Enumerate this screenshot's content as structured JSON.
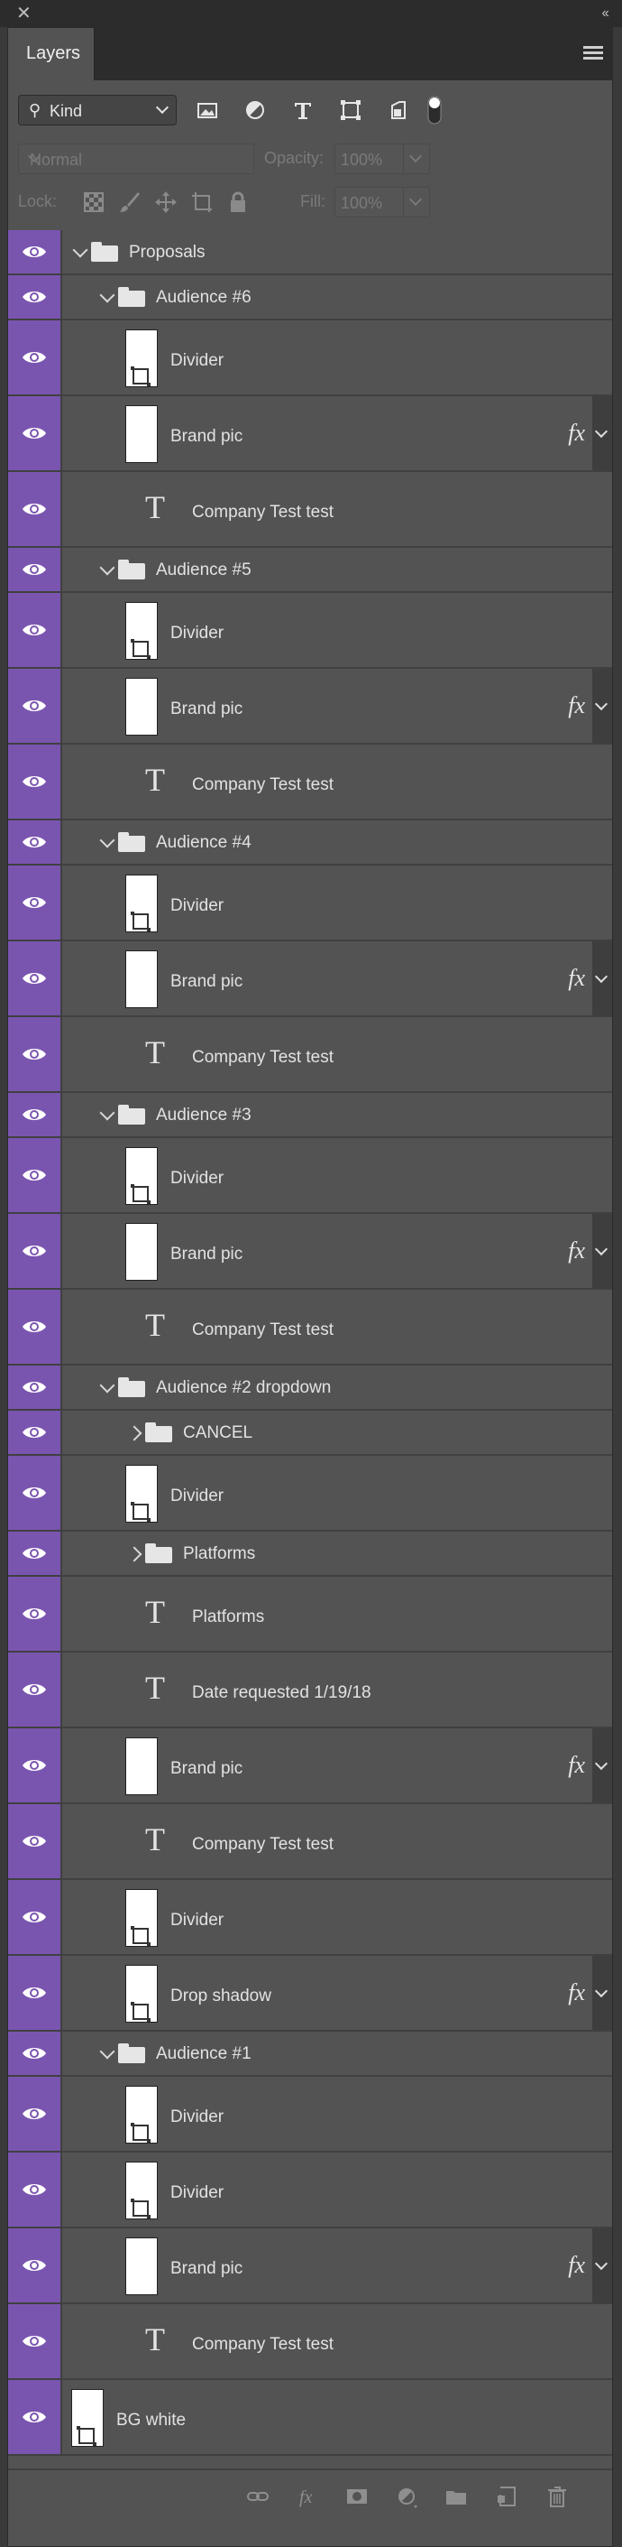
{
  "panel": {
    "tab_label": "Layers",
    "close_glyph": "✕",
    "collapse_glyph": "‹‹"
  },
  "filter": {
    "kind_label": "Kind",
    "icons": [
      "image-filter-icon",
      "adjustment-filter-icon",
      "type-filter-icon",
      "shape-filter-icon",
      "smart-object-filter-icon",
      "filter-toggle-icon"
    ]
  },
  "blend": {
    "mode": "Normal",
    "opacity_label": "Opacity:",
    "opacity_value": "100%",
    "lock_label": "Lock:",
    "fill_label": "Fill:",
    "fill_value": "100%"
  },
  "colors": {
    "visibility_column": "#7a55b0",
    "panel_bg": "#535353"
  },
  "layers": [
    {
      "name": "Proposals",
      "kind": "group",
      "depth": 0,
      "expanded": true
    },
    {
      "name": "Audience #6",
      "kind": "group",
      "depth": 1,
      "expanded": true
    },
    {
      "name": "Divider",
      "kind": "shape",
      "depth": 2
    },
    {
      "name": "Brand pic",
      "kind": "image",
      "depth": 2,
      "fx": true
    },
    {
      "name": "Company Test test",
      "kind": "text",
      "depth": 2
    },
    {
      "name": "Audience #5",
      "kind": "group",
      "depth": 1,
      "expanded": true
    },
    {
      "name": "Divider",
      "kind": "shape",
      "depth": 2
    },
    {
      "name": "Brand pic",
      "kind": "image",
      "depth": 2,
      "fx": true
    },
    {
      "name": "Company Test test",
      "kind": "text",
      "depth": 2
    },
    {
      "name": "Audience #4",
      "kind": "group",
      "depth": 1,
      "expanded": true
    },
    {
      "name": "Divider",
      "kind": "shape",
      "depth": 2
    },
    {
      "name": "Brand pic",
      "kind": "image",
      "depth": 2,
      "fx": true
    },
    {
      "name": "Company Test test",
      "kind": "text",
      "depth": 2
    },
    {
      "name": "Audience #3",
      "kind": "group",
      "depth": 1,
      "expanded": true
    },
    {
      "name": "Divider",
      "kind": "shape",
      "depth": 2
    },
    {
      "name": "Brand pic",
      "kind": "image",
      "depth": 2,
      "fx": true
    },
    {
      "name": "Company Test test",
      "kind": "text",
      "depth": 2
    },
    {
      "name": "Audience #2 dropdown",
      "kind": "group",
      "depth": 1,
      "expanded": true
    },
    {
      "name": "CANCEL",
      "kind": "group",
      "depth": 2,
      "expanded": false
    },
    {
      "name": "Divider",
      "kind": "shape",
      "depth": 2
    },
    {
      "name": "Platforms",
      "kind": "group",
      "depth": 2,
      "expanded": false
    },
    {
      "name": "Platforms",
      "kind": "text",
      "depth": 2
    },
    {
      "name": "Date requested 1/19/18",
      "kind": "text",
      "depth": 2
    },
    {
      "name": "Brand pic",
      "kind": "image",
      "depth": 2,
      "fx": true
    },
    {
      "name": "Company Test test",
      "kind": "text",
      "depth": 2
    },
    {
      "name": "Divider",
      "kind": "shape",
      "depth": 2
    },
    {
      "name": "Drop shadow",
      "kind": "shape",
      "depth": 2,
      "fx": true
    },
    {
      "name": "Audience #1",
      "kind": "group",
      "depth": 1,
      "expanded": true
    },
    {
      "name": "Divider",
      "kind": "shape",
      "depth": 2
    },
    {
      "name": "Divider",
      "kind": "shape",
      "depth": 2
    },
    {
      "name": "Brand pic",
      "kind": "image",
      "depth": 2,
      "fx": true
    },
    {
      "name": "Company Test test",
      "kind": "text",
      "depth": 2
    },
    {
      "name": "BG white",
      "kind": "shape",
      "depth": 0
    }
  ],
  "bottom_bar": {
    "icons": [
      "link-layers-icon",
      "add-layer-style-icon",
      "add-mask-icon",
      "new-adjustment-layer-icon",
      "new-group-icon",
      "new-layer-icon",
      "delete-layer-icon"
    ]
  }
}
